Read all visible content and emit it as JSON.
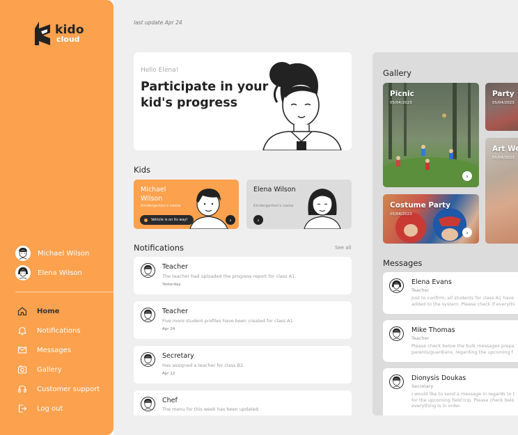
{
  "brand": {
    "name": "kido",
    "sub": "cloud"
  },
  "sidebar": {
    "kids": [
      {
        "name": "Michael Wilson"
      },
      {
        "name": "Elena Wilson"
      }
    ],
    "nav": [
      {
        "label": "Home",
        "icon": "home-icon",
        "active": true
      },
      {
        "label": "Notifications",
        "icon": "bell-icon"
      },
      {
        "label": "Messages",
        "icon": "mail-icon"
      },
      {
        "label": "Gallery",
        "icon": "gallery-icon"
      },
      {
        "label": "Customer support",
        "icon": "headset-icon"
      },
      {
        "label": "Log out",
        "icon": "logout-icon"
      }
    ]
  },
  "main": {
    "last_update": "last update Apr 24",
    "hero": {
      "greeting": "Hello Elena!",
      "title": "Participate in your kid's progress"
    },
    "kids_title": "Kids",
    "kid_cards": [
      {
        "name": "Michael Wilson",
        "school": "Kindergarten's name",
        "status": "Vehicle is on its way!"
      },
      {
        "name": "Elena Wilson",
        "school": "Kindergarten's name"
      }
    ],
    "notifications_title": "Notifications",
    "see_all": "See all",
    "notifications": [
      {
        "title": "Teacher",
        "body": "The teacher had uploaded the progress report for class A1.",
        "time": "Yesterday"
      },
      {
        "title": "Teacher",
        "body": "Five more student profiles have been created for class A1.",
        "time": "Apr 24"
      },
      {
        "title": "Secretary",
        "body": "Has assigned a teacher for class B2.",
        "time": "Apr 22"
      },
      {
        "title": "Chef",
        "body": "The menu for this week has been updated."
      }
    ]
  },
  "gallery": {
    "title": "Gallery",
    "items": [
      {
        "name": "Picnic",
        "date": "05/04/2023"
      },
      {
        "name": "Party",
        "date": "05/04/2023"
      },
      {
        "name": "Art We",
        "date": "05/04/2023"
      },
      {
        "name": "Costume Party",
        "date": "05/04/2023"
      }
    ]
  },
  "messages": {
    "title": "Messages",
    "items": [
      {
        "name": "Elena Evans",
        "role": "Teacher",
        "text1": "Just to confirm, all students for class A1 have",
        "text2": "added to the system. Please check if everythi"
      },
      {
        "name": "Mike Thomas",
        "role": "Teacher",
        "text1": "Please check below the bulk messages prepa",
        "text2": "parents/guardians, regarding the upcoming f"
      },
      {
        "name": "Dionysis Doukas",
        "role": "Secretary",
        "text1": "I would like to send a message in regards to t",
        "text2": "for the upcoming field trip. Please check belo",
        "text3": "everything is in order."
      }
    ]
  },
  "colors": {
    "accent": "#FCA14E",
    "dark": "#222222",
    "panel": "#DCDCDC",
    "background": "#EFEFEF"
  }
}
